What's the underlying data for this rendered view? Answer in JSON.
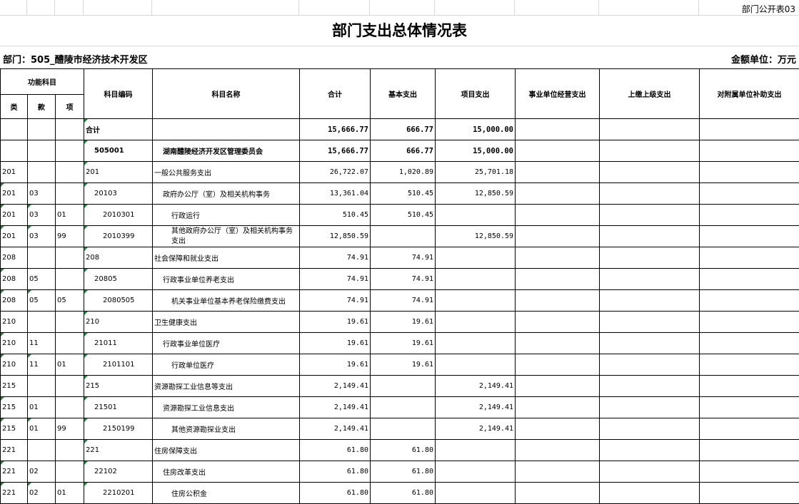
{
  "form_code": "部门公开表03",
  "title": "部门支出总体情况表",
  "department_label": "部门：505_醴陵市经济技术开发区",
  "unit_label": "金额单位：万元",
  "headers": {
    "func_subject": "功能科目",
    "lei": "类",
    "kuan": "款",
    "xiang": "项",
    "code": "科目编码",
    "name": "科目名称",
    "total": "合计",
    "basic": "基本支出",
    "project": "项目支出",
    "business": "事业单位经营支出",
    "upper": "上缴上级支出",
    "subsidy": "对附属单位补助支出"
  },
  "rows": [
    {
      "lei": "",
      "kuan": "",
      "xiang": "",
      "code": "合计",
      "name": "",
      "total": "15,666.77",
      "basic": "666.77",
      "project": "15,000.00",
      "level": "total"
    },
    {
      "lei": "",
      "kuan": "",
      "xiang": "",
      "code": "505001",
      "name": "湖南醴陵经济开发区管理委员会",
      "total": "15,666.77",
      "basic": "666.77",
      "project": "15,000.00",
      "level": "unit"
    },
    {
      "lei": "201",
      "kuan": "",
      "xiang": "",
      "code": "201",
      "name": "一般公共服务支出",
      "total": "26,722.07",
      "basic": "1,020.89",
      "project": "25,701.18",
      "level": "0"
    },
    {
      "lei": "201",
      "kuan": "03",
      "xiang": "",
      "code": "20103",
      "name": "政府办公厅（室）及相关机构事务",
      "total": "13,361.04",
      "basic": "510.45",
      "project": "12,850.59",
      "level": "1"
    },
    {
      "lei": "201",
      "kuan": "03",
      "xiang": "01",
      "code": "2010301",
      "name": "行政运行",
      "total": "510.45",
      "basic": "510.45",
      "project": "",
      "level": "2"
    },
    {
      "lei": "201",
      "kuan": "03",
      "xiang": "99",
      "code": "2010399",
      "name": "其他政府办公厅（室）及相关机构事务支出",
      "total": "12,850.59",
      "basic": "",
      "project": "12,850.59",
      "level": "2w"
    },
    {
      "lei": "208",
      "kuan": "",
      "xiang": "",
      "code": "208",
      "name": "社会保障和就业支出",
      "total": "74.91",
      "basic": "74.91",
      "project": "",
      "level": "0"
    },
    {
      "lei": "208",
      "kuan": "05",
      "xiang": "",
      "code": "20805",
      "name": "行政事业单位养老支出",
      "total": "74.91",
      "basic": "74.91",
      "project": "",
      "level": "1"
    },
    {
      "lei": "208",
      "kuan": "05",
      "xiang": "05",
      "code": "2080505",
      "name": "机关事业单位基本养老保险缴费支出",
      "total": "74.91",
      "basic": "74.91",
      "project": "",
      "level": "2"
    },
    {
      "lei": "210",
      "kuan": "",
      "xiang": "",
      "code": "210",
      "name": "卫生健康支出",
      "total": "19.61",
      "basic": "19.61",
      "project": "",
      "level": "0"
    },
    {
      "lei": "210",
      "kuan": "11",
      "xiang": "",
      "code": "21011",
      "name": "行政事业单位医疗",
      "total": "19.61",
      "basic": "19.61",
      "project": "",
      "level": "1"
    },
    {
      "lei": "210",
      "kuan": "11",
      "xiang": "01",
      "code": "2101101",
      "name": "行政单位医疗",
      "total": "19.61",
      "basic": "19.61",
      "project": "",
      "level": "2"
    },
    {
      "lei": "215",
      "kuan": "",
      "xiang": "",
      "code": "215",
      "name": "资源勘探工业信息等支出",
      "total": "2,149.41",
      "basic": "",
      "project": "2,149.41",
      "level": "0"
    },
    {
      "lei": "215",
      "kuan": "01",
      "xiang": "",
      "code": "21501",
      "name": "资源勘探工业信息支出",
      "total": "2,149.41",
      "basic": "",
      "project": "2,149.41",
      "level": "1"
    },
    {
      "lei": "215",
      "kuan": "01",
      "xiang": "99",
      "code": "2150199",
      "name": "其他资源勘探业支出",
      "total": "2,149.41",
      "basic": "",
      "project": "2,149.41",
      "level": "2"
    },
    {
      "lei": "221",
      "kuan": "",
      "xiang": "",
      "code": "221",
      "name": "住房保障支出",
      "total": "61.80",
      "basic": "61.80",
      "project": "",
      "level": "0"
    },
    {
      "lei": "221",
      "kuan": "02",
      "xiang": "",
      "code": "22102",
      "name": "住房改革支出",
      "total": "61.80",
      "basic": "61.80",
      "project": "",
      "level": "1"
    },
    {
      "lei": "221",
      "kuan": "02",
      "xiang": "01",
      "code": "2210201",
      "name": "住房公积金",
      "total": "61.80",
      "basic": "61.80",
      "project": "",
      "level": "2"
    }
  ]
}
